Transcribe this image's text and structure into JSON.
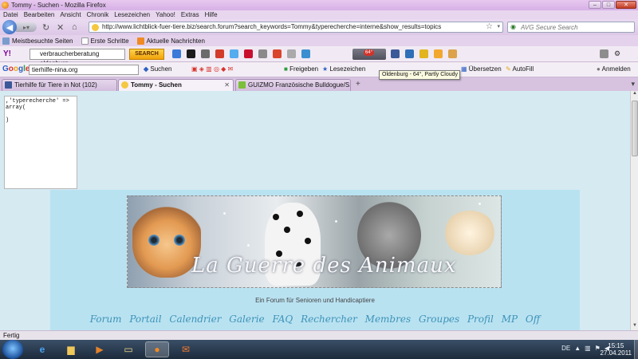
{
  "window": {
    "title": "Tommy - Suchen - Mozilla Firefox",
    "min": "–",
    "max": "□",
    "close": "✕"
  },
  "menu": [
    "Datei",
    "Bearbeiten",
    "Ansicht",
    "Chronik",
    "Lesezeichen",
    "Yahoo!",
    "Extras",
    "Hilfe"
  ],
  "nav": {
    "url": "http://www.lichtblick-fuer-tiere.biz/search.forum?search_keywords=Tommy&typerecherche=interne&show_results=topics",
    "search_placeholder": "AVG Secure Search"
  },
  "bookmarks": [
    "Meistbesuchte Seiten",
    "Erste Schritte",
    "Aktuelle Nachrichten"
  ],
  "yahoo_toolbar": {
    "logo": "Y!",
    "search_value": "verbraucherberatung oldenburg",
    "search_button": "SEARCH",
    "weather_temp": "64°"
  },
  "google_toolbar": {
    "search_value": "tierhilfe-nina.org",
    "items": [
      "Suchen",
      "Freigeben",
      "Lesezeichen",
      "Übersetzen",
      "AutoFill",
      "Anmelden"
    ]
  },
  "tooltip": "Oldenburg - 64°, Partly Cloudy",
  "tabs": [
    {
      "label": "Tierhilfe für Tiere in Not (102)",
      "active": false,
      "color": "#3b5998"
    },
    {
      "label": "Tommy - Suchen",
      "active": true,
      "color": "#f5c842"
    },
    {
      "label": "GUIZMO Französische Bulldogue/S...",
      "active": false,
      "color": "#7cbf3a"
    }
  ],
  "content": {
    "code": ",'typerecherche' =>\narray(\n\n)",
    "banner_title": "La Guerre des Animaux",
    "tagline": "Ein Forum für Senioren und Handicaptiere",
    "forum_nav": [
      "Forum",
      "Portail",
      "Calendrier",
      "Galerie",
      "FAQ",
      "Rechercher",
      "Membres",
      "Groupes",
      "Profil",
      "MP",
      "Off"
    ]
  },
  "status": "Fertig",
  "taskbar": {
    "lang": "DE",
    "time": "15:15",
    "date": "27.04.2011"
  },
  "colors": {
    "accent": "#3d93b8",
    "forum_bg": "#b9e2f1",
    "page_bg": "#d6eaf2"
  }
}
